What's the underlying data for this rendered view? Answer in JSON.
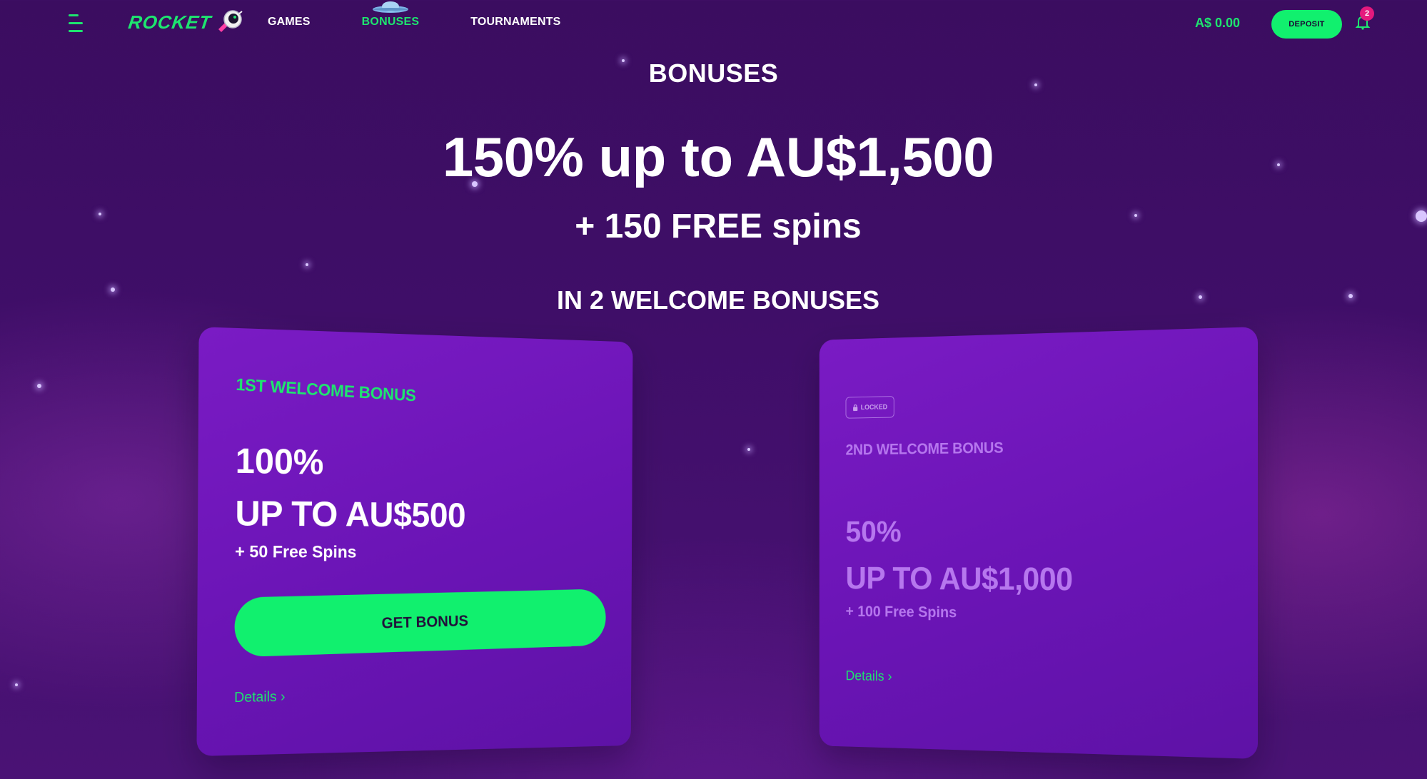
{
  "header": {
    "logo_text": "ROCKET",
    "nav": [
      {
        "label": "GAMES"
      },
      {
        "label": "BONUSES",
        "active": true
      },
      {
        "label": "TOURNAMENTS"
      }
    ],
    "balance": "A$ 0.00",
    "deposit_label": "DEPOSIT",
    "notification_count": "2"
  },
  "hero": {
    "page_title": "BONUSES",
    "headline": "150% up to AU$1,500",
    "subline": "+ 150 FREE spins",
    "bonus_count": "IN 2 WELCOME BONUSES"
  },
  "cards": [
    {
      "label": "1ST WELCOME BONUS",
      "percent": "100%",
      "amount": "UP TO AU$500",
      "spins": "+ 50 Free Spins",
      "button_label": "GET BONUS",
      "details_label": "Details ›"
    },
    {
      "locked_label": "LOCKED",
      "label": "2ND WELCOME BONUS",
      "percent": "50%",
      "amount": "UP TO AU$1,000",
      "spins": "+ 100 Free Spins",
      "details_label": "Details ›"
    }
  ],
  "colors": {
    "accent_green": "#11f06e",
    "background_purple": "#3f0e68",
    "card_purple": "#6a14b5",
    "locked_text": "#b677ee",
    "badge_pink": "#e5197d"
  },
  "icons": {
    "menu": "hamburger-icon",
    "mascot": "astronaut-icon",
    "ufo": "ufo-icon",
    "notifications": "bell-icon",
    "lock": "lock-icon"
  }
}
